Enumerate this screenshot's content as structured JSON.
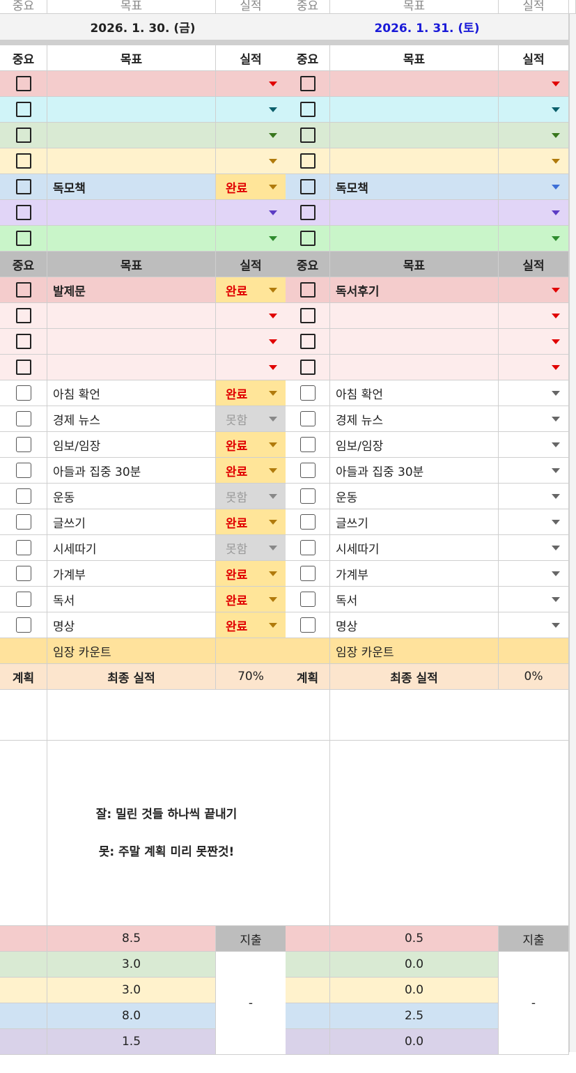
{
  "top_strip": [
    "중요",
    "목표",
    "실적",
    "중요",
    "목표",
    "실적"
  ],
  "days": [
    {
      "date": "2026. 1. 30. (금)",
      "date_color": "#222222",
      "header": {
        "important": "중요",
        "goal": "목표",
        "result": "실적"
      },
      "goals_a": [
        {
          "goal": "",
          "status": "",
          "color": "#f4cccc",
          "arrow": "#e00000"
        },
        {
          "goal": "",
          "status": "",
          "color": "#d0f4f8",
          "arrow": "#0b5f6b"
        },
        {
          "goal": "",
          "status": "",
          "color": "#d9ead3",
          "arrow": "#38761d"
        },
        {
          "goal": "",
          "status": "",
          "color": "#fff2cc",
          "arrow": "#b07a0c"
        },
        {
          "goal": "독모책",
          "status": "완료",
          "color": "#cfe2f3",
          "arrow": "#b07a0c"
        },
        {
          "goal": "",
          "status": "",
          "color": "#e1d5f7",
          "arrow": "#5b3cc4"
        },
        {
          "goal": "",
          "status": "",
          "color": "#c9f5c9",
          "arrow": "#2e8b2e"
        }
      ],
      "header2": {
        "important": "중요",
        "goal": "목표",
        "result": "실적"
      },
      "goals_b": [
        {
          "goal": "발제문",
          "status": "완료",
          "color": "#f4cccc",
          "arrow": "#b07a0c"
        },
        {
          "goal": "",
          "status": "",
          "color": "#fdecec",
          "arrow": "#e00000"
        },
        {
          "goal": "",
          "status": "",
          "color": "#fdecec",
          "arrow": "#e00000"
        },
        {
          "goal": "",
          "status": "",
          "color": "#fdecec",
          "arrow": "#e00000"
        }
      ],
      "routines": [
        {
          "label": "아침 확언",
          "status": "완료"
        },
        {
          "label": "경제 뉴스",
          "status": "못함"
        },
        {
          "label": "임보/임장",
          "status": "완료"
        },
        {
          "label": "아들과 집중 30분",
          "status": "완료"
        },
        {
          "label": "운동",
          "status": "못함"
        },
        {
          "label": "글쓰기",
          "status": "완료"
        },
        {
          "label": "시세따기",
          "status": "못함"
        },
        {
          "label": "가계부",
          "status": "완료"
        },
        {
          "label": "독서",
          "status": "완료"
        },
        {
          "label": "명상",
          "status": "완료"
        }
      ],
      "imjang_count": "임장 카운트",
      "final": {
        "plan": "계획",
        "label": "최종 실적",
        "value": "70%"
      },
      "remarks": [
        "잘: 밀린 것들 하나씩 끝내기",
        "못: 주말 계획 미리 못짠것!"
      ],
      "expenses": {
        "label": "지출",
        "values": [
          "8.5",
          "3.0",
          "3.0",
          "8.0",
          "1.5"
        ],
        "dash": "-"
      }
    },
    {
      "date": "2026. 1. 31. (토)",
      "date_color": "#1a1ad8",
      "header": {
        "important": "중요",
        "goal": "목표",
        "result": "실적"
      },
      "goals_a": [
        {
          "goal": "",
          "status": "",
          "color": "#f4cccc",
          "arrow": "#e00000"
        },
        {
          "goal": "",
          "status": "",
          "color": "#d0f4f8",
          "arrow": "#0b5f6b"
        },
        {
          "goal": "",
          "status": "",
          "color": "#d9ead3",
          "arrow": "#38761d"
        },
        {
          "goal": "",
          "status": "",
          "color": "#fff2cc",
          "arrow": "#b07a0c"
        },
        {
          "goal": "독모책",
          "status": "",
          "color": "#cfe2f3",
          "arrow": "#3d6fd6"
        },
        {
          "goal": "",
          "status": "",
          "color": "#e1d5f7",
          "arrow": "#5b3cc4"
        },
        {
          "goal": "",
          "status": "",
          "color": "#c9f5c9",
          "arrow": "#2e8b2e"
        }
      ],
      "header2": {
        "important": "중요",
        "goal": "목표",
        "result": "실적"
      },
      "goals_b": [
        {
          "goal": "독서후기",
          "status": "",
          "color": "#f4cccc",
          "arrow": "#e00000"
        },
        {
          "goal": "",
          "status": "",
          "color": "#fdecec",
          "arrow": "#e00000"
        },
        {
          "goal": "",
          "status": "",
          "color": "#fdecec",
          "arrow": "#e00000"
        },
        {
          "goal": "",
          "status": "",
          "color": "#fdecec",
          "arrow": "#e00000"
        }
      ],
      "routines": [
        {
          "label": "아침 확언",
          "status": ""
        },
        {
          "label": "경제 뉴스",
          "status": ""
        },
        {
          "label": "임보/임장",
          "status": ""
        },
        {
          "label": "아들과 집중 30분",
          "status": ""
        },
        {
          "label": "운동",
          "status": ""
        },
        {
          "label": "글쓰기",
          "status": ""
        },
        {
          "label": "시세따기",
          "status": ""
        },
        {
          "label": "가계부",
          "status": ""
        },
        {
          "label": "독서",
          "status": ""
        },
        {
          "label": "명상",
          "status": ""
        }
      ],
      "imjang_count": "임장 카운트",
      "final": {
        "plan": "계획",
        "label": "최종 실적",
        "value": "0%"
      },
      "remarks": [],
      "expenses": {
        "label": "지출",
        "values": [
          "0.5",
          "0.0",
          "0.0",
          "2.5",
          "0.0"
        ],
        "dash": "-"
      }
    }
  ],
  "colors": {
    "header_gray": "#bdbdbd",
    "date_row": "#f3f3f3",
    "done_bg": "#ffe599",
    "notdone_bg": "#d9d9d9",
    "imjang_bg": "#ffe29c",
    "final_bg": "#fce5cd",
    "expense_colors": [
      "#f4cccc",
      "#d9ead3",
      "#fff2cc",
      "#cfe2f3",
      "#d9d2e9"
    ],
    "expense_header": "#bdbdbd"
  }
}
